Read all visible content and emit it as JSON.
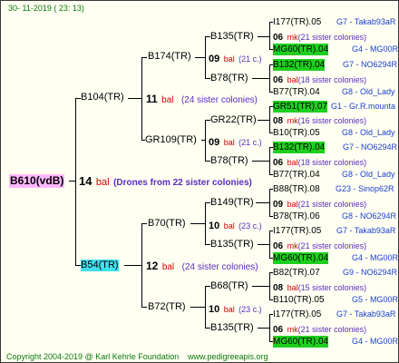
{
  "date": "30- 11-2019 ( 23: 13)",
  "footer": {
    "copyright": "Copyright 2004-2019 @ Karl Kehrle Foundation",
    "site": "www.pedigreeapis.org"
  },
  "root": {
    "name": "B610(vdB)",
    "num": "14",
    "bal": "bal",
    "note": "(Drones from 22 sister colonies)"
  },
  "g1": [
    {
      "name": "B104(TR)",
      "num": "11",
      "bal": "bal",
      "note": "(24 sister colonies)"
    },
    {
      "name": "B54(TR)",
      "num": "12",
      "bal": "bal",
      "note": "(24 sister colonies)"
    }
  ],
  "g2": [
    {
      "name": "B174(TR)",
      "num": "09",
      "bal": "bal",
      "note": "(21 c.)"
    },
    {
      "name": "GR109(TR)",
      "num": "09",
      "bal": "bal",
      "note": "(21 c.)"
    },
    {
      "name": "B70(TR)",
      "num": "10",
      "bal": "bal",
      "note": "(23 c.)"
    },
    {
      "name": "B72(TR)",
      "num": "10",
      "bal": "bal",
      "note": "(23 c.)"
    }
  ],
  "g3": [
    {
      "name": "B135(TR)",
      "num": "06",
      "bal": "mk",
      "note": "(21 sister colonies)"
    },
    {
      "name": "B78(TR)",
      "num": "06",
      "bal": "bal",
      "note": "(18 sister colonies)"
    },
    {
      "name": "GR22(TR)",
      "num": "08",
      "bal": "mk",
      "note": "(16 sister colonies)"
    },
    {
      "name": "B78(TR)",
      "num": "06",
      "bal": "bal",
      "note": "(18 sister colonies)"
    },
    {
      "name": "B149(TR)",
      "num": "09",
      "bal": "bal",
      "note": "(21 sister colonies)"
    },
    {
      "name": "B135(TR)",
      "num": "06",
      "bal": "mk",
      "note": "(21 sister colonies)"
    },
    {
      "name": "B68(TR)",
      "num": "08",
      "bal": "bal",
      "note": "(15 sister colonies)"
    },
    {
      "name": "B135(TR)",
      "num": "06",
      "bal": "mk",
      "note": "(21 sister colonies)"
    }
  ],
  "g4": [
    {
      "name": "I177(TR).05",
      "info": "G7 - Takab93aR"
    },
    {
      "name": "MG60(TR).04",
      "info": "G4 - MG00R"
    },
    {
      "name": "B132(TR).04",
      "info": "G7 - NO6294R"
    },
    {
      "name": "B77(TR).04",
      "info": "G8 - Old_Lady"
    },
    {
      "name": "GR51(TR).07",
      "info": "G1 - Gr.R.mounta"
    },
    {
      "name": "B10(TR).05",
      "info": "G8 - Old_Lady"
    },
    {
      "name": "B132(TR).04",
      "info": "G7 - NO6294R"
    },
    {
      "name": "B77(TR).04",
      "info": "G8 - Old_Lady"
    },
    {
      "name": "B88(TR).08",
      "info": "G23 - Sinop62R"
    },
    {
      "name": "B78(TR).06",
      "info": "G8 - NO6294R"
    },
    {
      "name": "I177(TR).05",
      "info": "G7 - Takab93aR"
    },
    {
      "name": "MG60(TR).04",
      "info": "G4 - MG00R"
    },
    {
      "name": "B82(TR).07",
      "info": "G9 - NO6294R"
    },
    {
      "name": "B110(TR).05",
      "info": "G5 - MG00R"
    },
    {
      "name": "I177(TR).05",
      "info": "G7 - Takab93aR"
    },
    {
      "name": "MG60(TR).04",
      "info": "G4 - MG00R"
    }
  ]
}
